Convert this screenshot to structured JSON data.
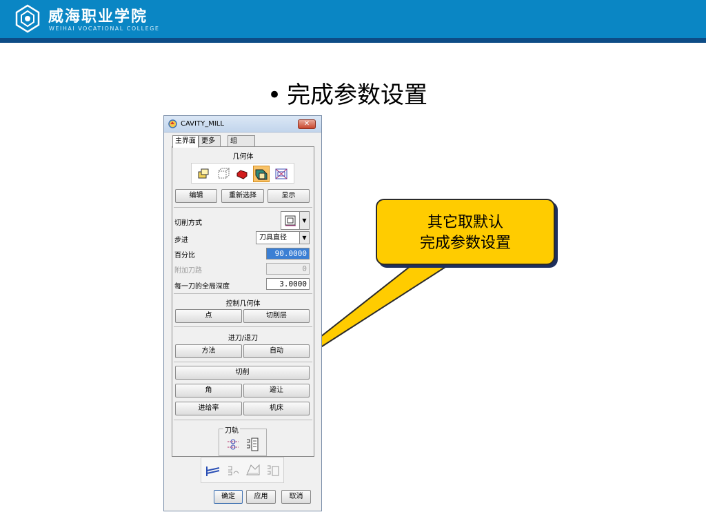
{
  "slide": {
    "school_name": "威海职业学院",
    "school_name_en": "WEIHAI VOCATIONAL COLLEGE",
    "bullet": "•",
    "title": "完成参数设置"
  },
  "dialog": {
    "title": "CAVITY_MILL",
    "close_label": "✕",
    "tabs": [
      {
        "label": "主界面",
        "active": true
      },
      {
        "label": "更多",
        "active": false
      },
      {
        "label": "组",
        "active": false
      }
    ],
    "geometry_heading": "几何体",
    "geometry_buttons": [
      "编辑",
      "重新选择",
      "显示"
    ],
    "cut_pattern_label": "切削方式",
    "stepover_label": "步进",
    "stepover_value": "刀具直径",
    "percent_label": "百分比",
    "percent_value": "90.0000",
    "extra_passes_label": "附加刀路",
    "extra_passes_value": "0",
    "depth_label": "每一刀的全局深度",
    "depth_value": "3.0000",
    "control_geometry_heading": "控制几何体",
    "control_buttons": [
      "点",
      "切削层"
    ],
    "engage_heading": "进刀/退刀",
    "engage_buttons": [
      "方法",
      "自动"
    ],
    "cutting_button": "切削",
    "corner_button": "角",
    "avoidance_button": "避让",
    "feed_button": "进给率",
    "machine_button": "机床",
    "toolpath_heading": "刀轨",
    "ok_button": "确定",
    "apply_button": "应用",
    "cancel_button": "取消"
  },
  "callout": {
    "line1": "其它取默认",
    "line2": "完成参数设置"
  },
  "colors": {
    "header_blue": "#0a86c4",
    "header_dark": "#0d4c86",
    "callout_yellow": "#ffcc00",
    "selection_blue": "#3b7fd4"
  }
}
